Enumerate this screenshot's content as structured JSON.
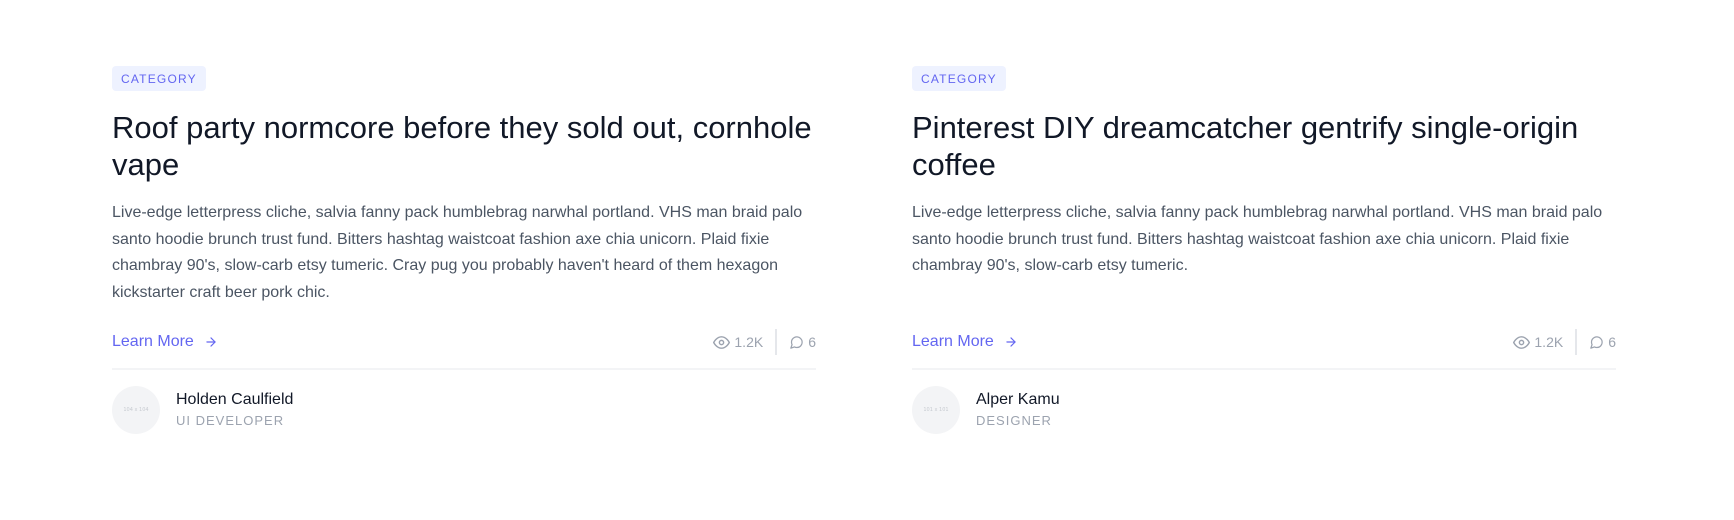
{
  "colors": {
    "accent": "#6366f1",
    "category_bg": "#eef2ff",
    "text_primary": "#111827",
    "text_secondary": "#4b5563",
    "muted": "#9ca3af"
  },
  "cards": [
    {
      "category": "CATEGORY",
      "title": "Roof party normcore before they sold out, cornhole vape",
      "description": "Live-edge letterpress cliche, salvia fanny pack humblebrag narwhal portland. VHS man braid palo santo hoodie brunch trust fund. Bitters hashtag waistcoat fashion axe chia unicorn. Plaid fixie chambray 90's, slow-carb etsy tumeric. Cray pug you probably haven't heard of them hexagon kickstarter craft beer pork chic.",
      "learn_more": "Learn More",
      "views": "1.2K",
      "comments": "6",
      "author": {
        "avatar_text": "104 x 104",
        "name": "Holden Caulfield",
        "role": "UI DEVELOPER"
      }
    },
    {
      "category": "CATEGORY",
      "title": "Pinterest DIY dreamcatcher gentrify single-origin coffee",
      "description": "Live-edge letterpress cliche, salvia fanny pack humblebrag narwhal portland. VHS man braid palo santo hoodie brunch trust fund. Bitters hashtag waistcoat fashion axe chia unicorn. Plaid fixie chambray 90's, slow-carb etsy tumeric.",
      "learn_more": "Learn More",
      "views": "1.2K",
      "comments": "6",
      "author": {
        "avatar_text": "101 x 101",
        "name": "Alper Kamu",
        "role": "DESIGNER"
      }
    }
  ]
}
